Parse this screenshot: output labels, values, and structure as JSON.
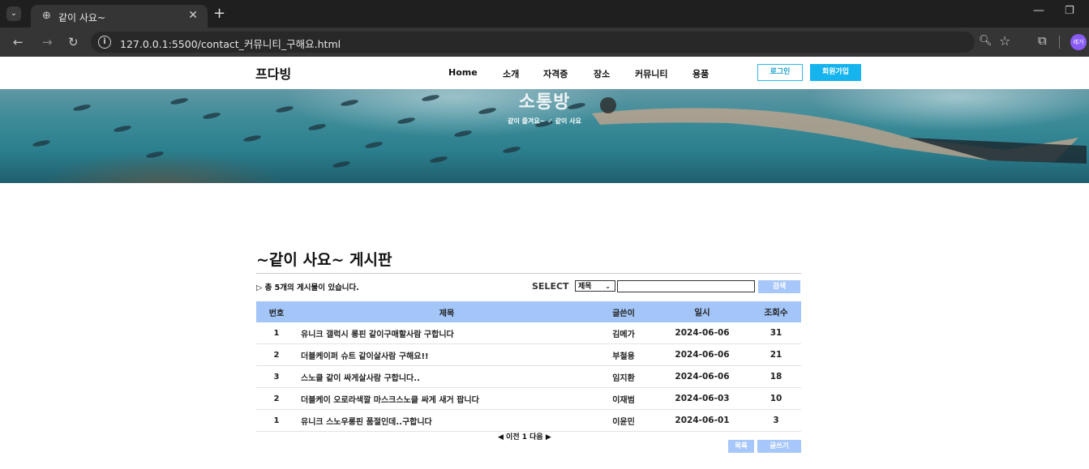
{
  "browser": {
    "tab_title": "같이 사요~",
    "url": "127.0.0.1:5500/contact_커뮤니티_구해요.html",
    "profile_label": "레거"
  },
  "header": {
    "logo": "프다빙",
    "nav": [
      "Home",
      "소개",
      "자격증",
      "장소",
      "커뮤니티",
      "용품"
    ],
    "login_label": "로그인",
    "join_label": "회원가입"
  },
  "hero": {
    "title": "소통방",
    "breadcrumb": "같이 즐겨요~ ✓ 같이 사요"
  },
  "board": {
    "title": "~같이 사요~ 게시판",
    "count_text": "▷ 총 5개의 게시물이 있습니다.",
    "select_label": "SELECT",
    "select_value": "제목",
    "search_value": "",
    "search_button": "검색",
    "columns": [
      "번호",
      "제목",
      "글쓴이",
      "일시",
      "조회수"
    ],
    "rows": [
      {
        "num": "1",
        "title": "유니크 갤럭시 롱핀 같이구매할사람 구합니다",
        "writer": "김메가",
        "date": "2024-06-06",
        "views": "31"
      },
      {
        "num": "2",
        "title": "더블케이퍼 슈트 같이살사람 구해요!!",
        "writer": "부철용",
        "date": "2024-06-06",
        "views": "21"
      },
      {
        "num": "3",
        "title": "스노클 같이 싸게살사람 구합니다..",
        "writer": "임지환",
        "date": "2024-06-06",
        "views": "18"
      },
      {
        "num": "2",
        "title": "더블케이 오로라색깔 마스크스노클 싸게 새거 팝니다",
        "writer": "이재범",
        "date": "2024-06-03",
        "views": "10"
      },
      {
        "num": "1",
        "title": "유니크 스노우롱핀 품절인데..구합니다",
        "writer": "이윤민",
        "date": "2024-06-01",
        "views": "3"
      }
    ],
    "pager": "◀ 이전 1 다음 ▶",
    "list_button": "목록",
    "write_button": "글쓰기"
  },
  "colors": {
    "table_header": "#a3c5f7",
    "button_light_blue": "#a7c7fa",
    "join_button": "#16b4ee",
    "login_border": "#2eb8e6"
  }
}
